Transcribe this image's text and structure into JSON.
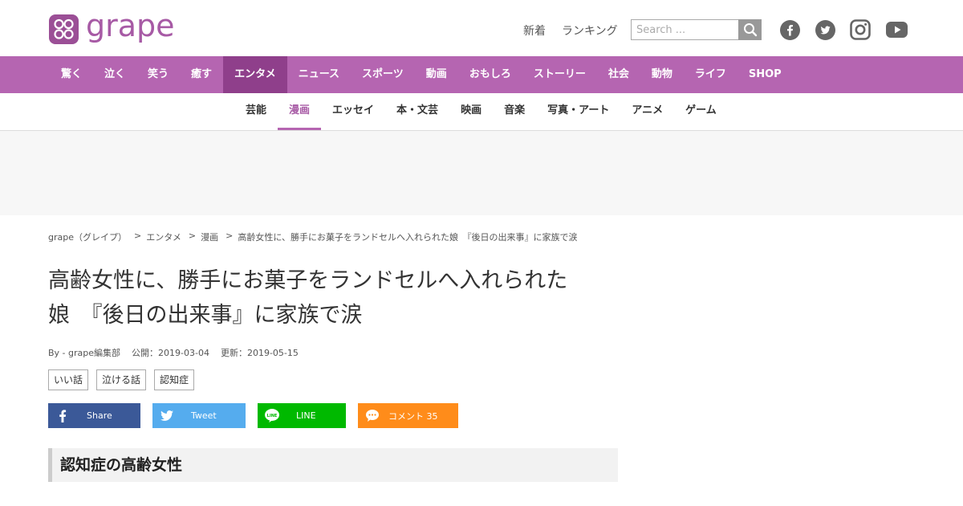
{
  "header": {
    "logo_text": "grape",
    "links": [
      "新着",
      "ランキング"
    ],
    "search_placeholder": "Search ...",
    "social": [
      "facebook-icon",
      "twitter-icon",
      "instagram-icon",
      "youtube-icon"
    ]
  },
  "nav1": {
    "items": [
      "驚く",
      "泣く",
      "笑う",
      "癒す",
      "エンタメ",
      "ニュース",
      "スポーツ",
      "動画",
      "おもしろ",
      "ストーリー",
      "社会",
      "動物",
      "ライフ",
      "SHOP"
    ],
    "active": "エンタメ"
  },
  "nav2": {
    "items": [
      "芸能",
      "漫画",
      "エッセイ",
      "本・文芸",
      "映画",
      "音楽",
      "写真・アート",
      "アニメ",
      "ゲーム"
    ],
    "active": "漫画"
  },
  "breadcrumb": [
    "grape（グレイプ）",
    "エンタメ",
    "漫画",
    "高齢女性に、勝手にお菓子をランドセルへ入れられた娘　『後日の出来事』に家族で涙"
  ],
  "article": {
    "title_line1": "高齢女性に、勝手にお菓子をランドセルへ入れられた",
    "title_line2": "娘　『後日の出来事』に家族で涙",
    "author": "By - grape編集部",
    "published": "公開：2019-03-04",
    "updated": "更新：2019-05-15",
    "tags": [
      "いい話",
      "泣ける話",
      "認知症"
    ],
    "section_heading": "認知症の高齢女性"
  },
  "share": {
    "facebook": "Share",
    "twitter": "Tweet",
    "line": "LINE",
    "comment": "コメント 35"
  },
  "colors": {
    "brand": "#b565b1",
    "brand_dark": "#8f3f8b",
    "facebook": "#3b5998",
    "twitter": "#55acee",
    "line": "#00b900",
    "comment": "#ff8c1a"
  }
}
